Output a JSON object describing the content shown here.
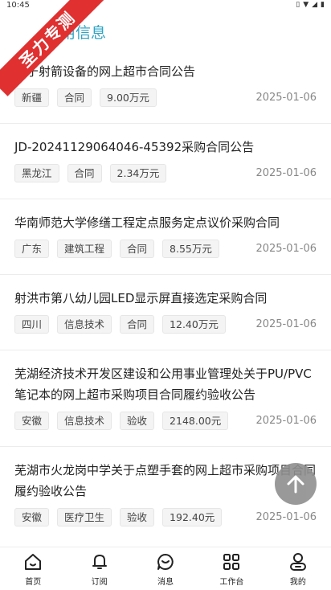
{
  "status_bar": {
    "time": "10:45"
  },
  "banner": {
    "text": "圣力专测"
  },
  "header": {
    "title": "信用信息"
  },
  "items": [
    {
      "title": "关于射箭设备的网上超市合同公告",
      "tags": [
        "新疆",
        "合同",
        "9.00万元"
      ],
      "date": "2025-01-06"
    },
    {
      "title": "JD-20241129064046-45392采购合同公告",
      "tags": [
        "黑龙江",
        "合同",
        "2.34万元"
      ],
      "date": "2025-01-06"
    },
    {
      "title": "华南师范大学修缮工程定点服务定点议价采购合同",
      "tags": [
        "广东",
        "建筑工程",
        "合同",
        "8.55万元"
      ],
      "date": "2025-01-06"
    },
    {
      "title": "射洪市第八幼儿园LED显示屏直接选定采购合同",
      "tags": [
        "四川",
        "信息技术",
        "合同",
        "12.40万元"
      ],
      "date": "2025-01-06"
    },
    {
      "title": "芜湖经济技术开发区建设和公用事业管理处关于PU/PVC笔记本的网上超市采购项目合同履约验收公告",
      "tags": [
        "安徽",
        "信息技术",
        "验收",
        "2148.00元"
      ],
      "date": "2025-01-06"
    },
    {
      "title": "芜湖市火龙岗中学关于点塑手套的网上超市采购项目合同履约验收公告",
      "tags": [
        "安徽",
        "医疗卫生",
        "验收",
        "192.40元"
      ],
      "date": "2025-01-06"
    }
  ],
  "tabbar": {
    "tabs": [
      {
        "label": "首页",
        "icon": "home-icon"
      },
      {
        "label": "订阅",
        "icon": "bell-icon"
      },
      {
        "label": "消息",
        "icon": "chat-icon"
      },
      {
        "label": "工作台",
        "icon": "grid-icon"
      },
      {
        "label": "我的",
        "icon": "user-icon"
      }
    ]
  }
}
